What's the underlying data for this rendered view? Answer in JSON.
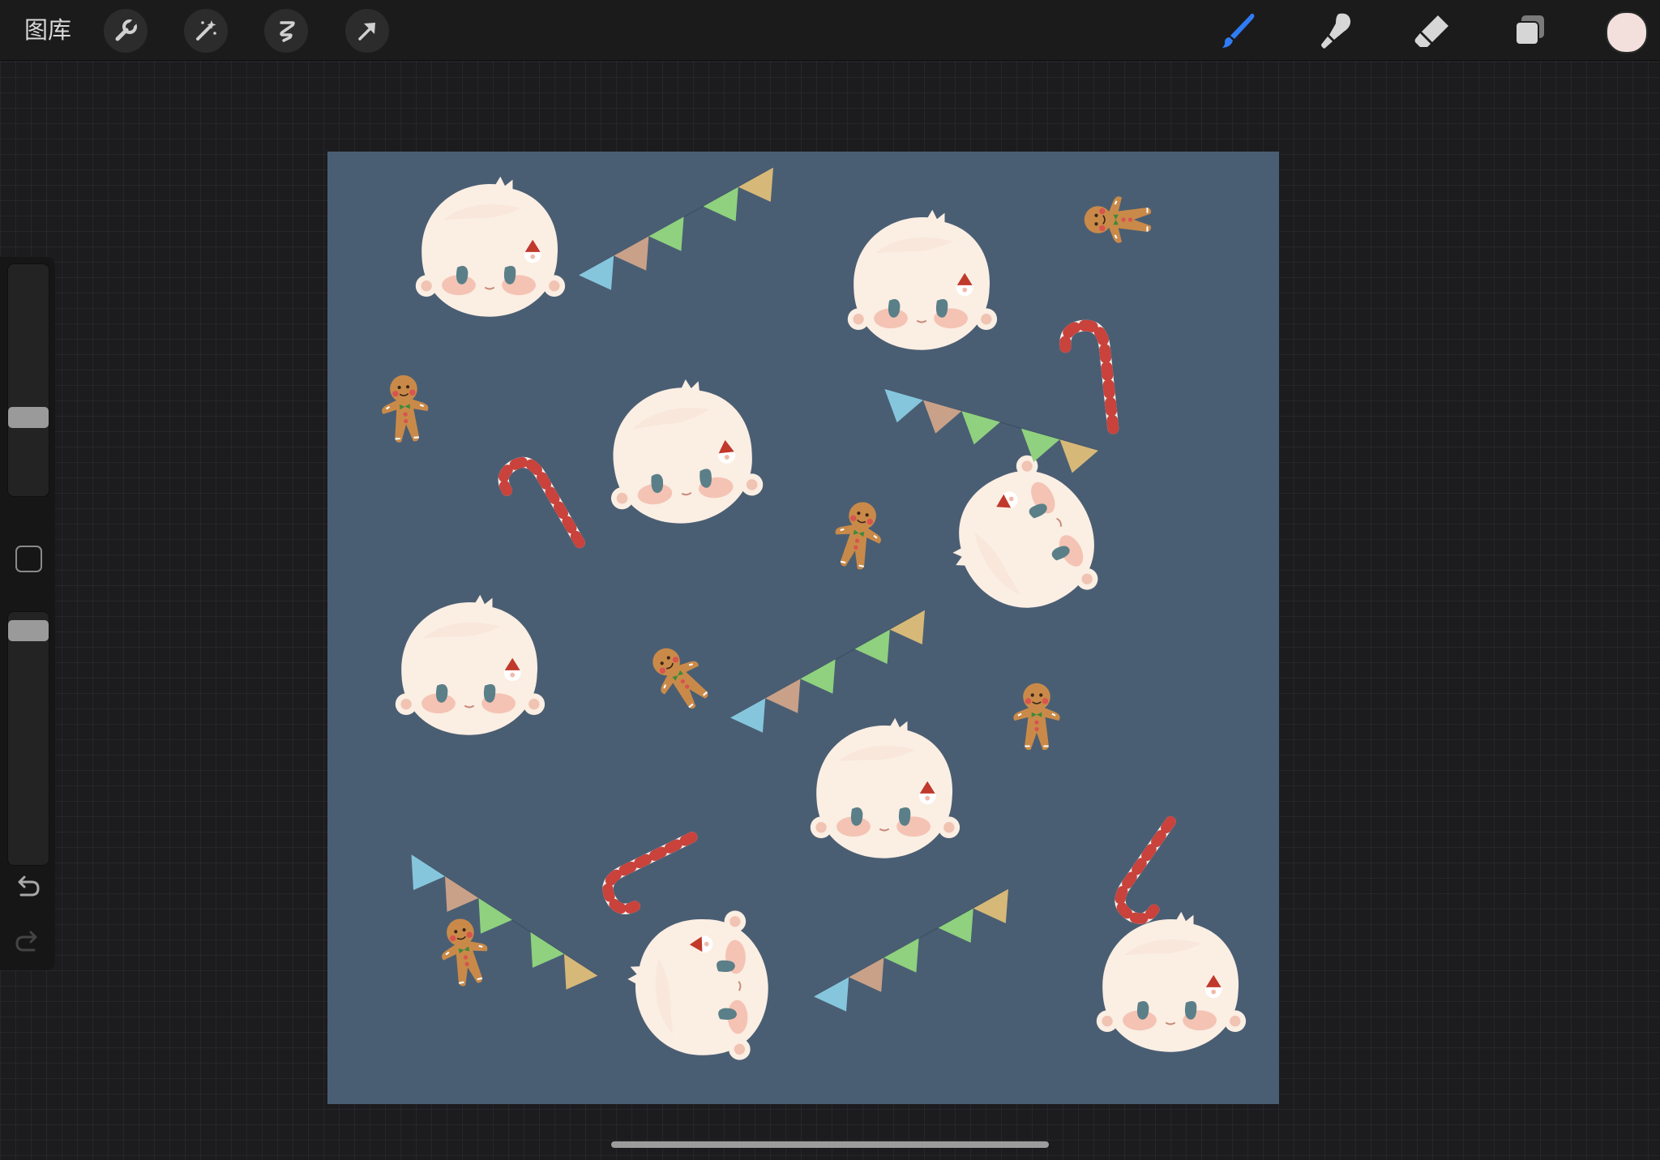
{
  "topbar": {
    "gallery_label": "图库",
    "left_tools": [
      "wrench-icon",
      "magic-wand-icon",
      "selection-icon",
      "transform-arrow-icon"
    ],
    "right_tools": [
      "brush-icon",
      "smudge-icon",
      "eraser-icon",
      "layers-icon"
    ],
    "active_tool": "brush-icon",
    "accent_color": "#2f7cf6",
    "current_color": "#f3e0dd"
  },
  "sidebar": {
    "brush_size_level": 0.62,
    "opacity_level": 0.08,
    "modifier_icon": "square-modifier-icon",
    "undo_icon": "undo-icon",
    "redo_icon": "redo-icon"
  },
  "canvas": {
    "background_color": "#4a5e73",
    "artwork_elements": [
      "character-head",
      "bunting-flags",
      "gingerbread-man",
      "candy-cane"
    ]
  }
}
